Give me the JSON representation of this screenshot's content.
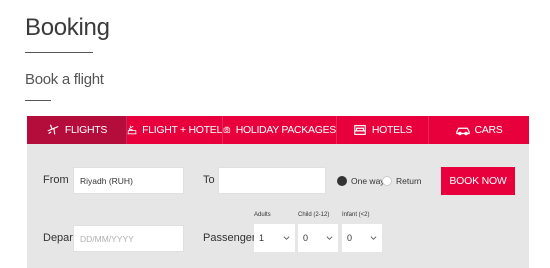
{
  "page": {
    "title": "Booking",
    "subtitle": "Book a flight"
  },
  "tabs": [
    {
      "label": "FLIGHTS",
      "icon": "plane-icon",
      "active": true
    },
    {
      "label": "FLIGHT + HOTEL",
      "icon": "plane-bed-icon",
      "active": false
    },
    {
      "label": "HOLIDAY PACKAGES",
      "icon": "camera-icon",
      "active": false
    },
    {
      "label": "HOTELS",
      "icon": "bed-icon",
      "active": false
    },
    {
      "label": "CARS",
      "icon": "car-icon",
      "active": false
    }
  ],
  "form": {
    "from_label": "From",
    "from_value": "Riyadh (RUH)",
    "to_label": "To",
    "to_value": "",
    "trip_options": [
      {
        "label": "One way",
        "selected": true
      },
      {
        "label": "Return",
        "selected": false
      }
    ],
    "book_label": "BOOK NOW",
    "depart_label": "Depart",
    "depart_placeholder": "DD/MM/YYYY",
    "passengers_label": "Passengers",
    "adults_label": "Adults",
    "adults_value": "1",
    "child_label": "Child (2-12)",
    "child_value": "0",
    "infant_label": "Infant (<2)",
    "infant_value": "0"
  },
  "colors": {
    "accent": "#e8003d",
    "active_tab": "#b40c3b",
    "form_bg": "#e6e6e6"
  }
}
